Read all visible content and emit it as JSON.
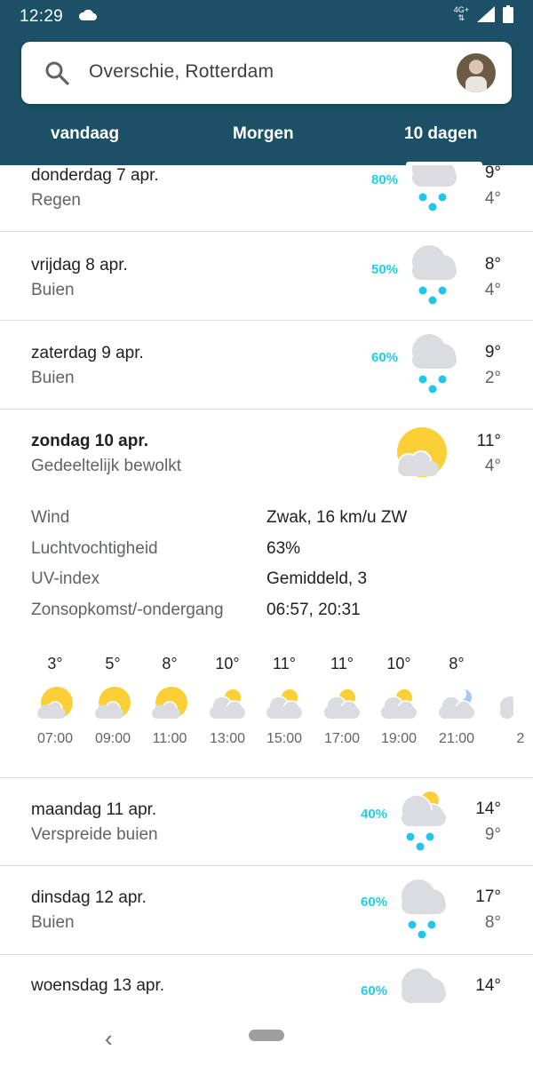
{
  "status": {
    "time": "12:29",
    "network": "4G+"
  },
  "search": {
    "location": "Overschie, Rotterdam"
  },
  "tabs": [
    {
      "label": "vandaag",
      "selected": false
    },
    {
      "label": "Morgen",
      "selected": false
    },
    {
      "label": "10 dagen",
      "selected": true
    }
  ],
  "days": [
    {
      "day": "donderdag 7 apr.",
      "condition": "Regen",
      "precip": "80%",
      "high": "9°",
      "low": "4°",
      "icon": "rain-icon"
    },
    {
      "day": "vrijdag 8 apr.",
      "condition": "Buien",
      "precip": "50%",
      "high": "8°",
      "low": "4°",
      "icon": "rain-icon"
    },
    {
      "day": "zaterdag 9 apr.",
      "condition": "Buien",
      "precip": "60%",
      "high": "9°",
      "low": "2°",
      "icon": "rain-icon"
    },
    {
      "day": "zondag 10 apr.",
      "condition": "Gedeeltelijk bewolkt",
      "precip": "",
      "high": "11°",
      "low": "4°",
      "icon": "partly-cloudy-icon"
    },
    {
      "day": "maandag 11 apr.",
      "condition": "Verspreide buien",
      "precip": "40%",
      "high": "14°",
      "low": "9°",
      "icon": "scattered-showers-icon"
    },
    {
      "day": "dinsdag 12 apr.",
      "condition": "Buien",
      "precip": "60%",
      "high": "17°",
      "low": "8°",
      "icon": "rain-icon"
    },
    {
      "day": "woensdag 13 apr.",
      "condition": "",
      "precip": "60%",
      "high": "14°",
      "low": "",
      "icon": "rain-icon"
    }
  ],
  "details": [
    {
      "label": "Wind",
      "value": "Zwak, 16 km/u ZW"
    },
    {
      "label": "Luchtvochtigheid",
      "value": "63%"
    },
    {
      "label": "UV-index",
      "value": "Gemiddeld, 3"
    },
    {
      "label": "Zonsopkomst/-ondergang",
      "value": "06:57, 20:31"
    }
  ],
  "hourly": [
    {
      "temp": "3°",
      "time": "07:00",
      "icon": "partly-sunny-icon"
    },
    {
      "temp": "5°",
      "time": "09:00",
      "icon": "partly-sunny-icon"
    },
    {
      "temp": "8°",
      "time": "11:00",
      "icon": "partly-sunny-icon"
    },
    {
      "temp": "10°",
      "time": "13:00",
      "icon": "mostly-cloudy-icon"
    },
    {
      "temp": "11°",
      "time": "15:00",
      "icon": "mostly-cloudy-icon"
    },
    {
      "temp": "11°",
      "time": "17:00",
      "icon": "mostly-cloudy-icon"
    },
    {
      "temp": "10°",
      "time": "19:00",
      "icon": "mostly-cloudy-icon"
    },
    {
      "temp": "8°",
      "time": "21:00",
      "icon": "cloudy-night-icon"
    },
    {
      "temp": "",
      "time": "2",
      "icon": "cloud-icon"
    }
  ],
  "colors": {
    "header": "#1b5066",
    "precip": "#1fd1e6",
    "sun": "#fbd036",
    "cloud": "#dadce0",
    "rain": "#23c6e8"
  }
}
